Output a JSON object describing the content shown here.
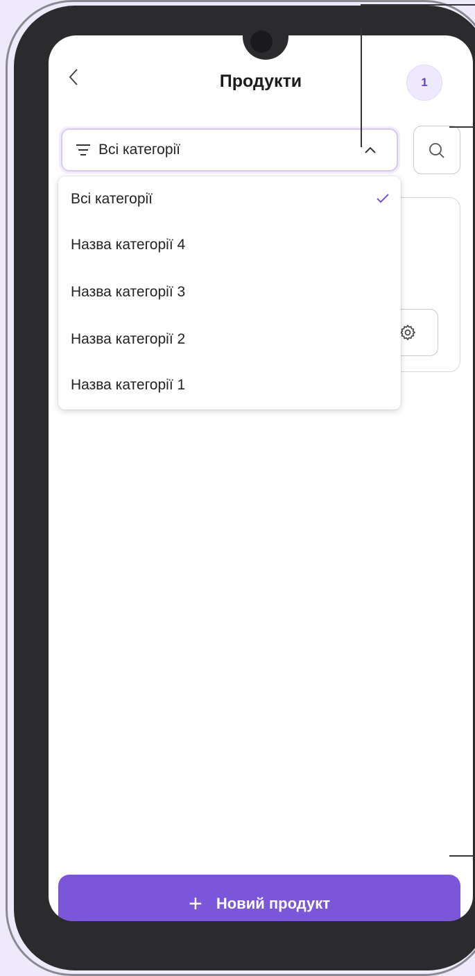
{
  "header": {
    "back_icon": "chevron-left-icon",
    "title": "Продукти",
    "badge_count": "1"
  },
  "filter": {
    "selected_label": "Всі категорії",
    "icon": "filter-lines-icon",
    "chevron": "chevron-up-icon"
  },
  "search": {
    "icon": "search-icon"
  },
  "dropdown": {
    "items": [
      {
        "label": "Всі категорії",
        "selected": true
      },
      {
        "label": "Назва категорії 4",
        "selected": false
      },
      {
        "label": "Назва категорії 3",
        "selected": false
      },
      {
        "label": "Назва категорії 2",
        "selected": false
      },
      {
        "label": "Назва категорії 1",
        "selected": false
      }
    ]
  },
  "card": {
    "gear_icon": "gear-icon"
  },
  "footer": {
    "add_button_label": "Новий продукт",
    "add_icon": "plus-icon"
  },
  "colors": {
    "accent": "#7b56d8",
    "badge_bg": "#efe9fd",
    "page_bg": "#efeafb"
  }
}
